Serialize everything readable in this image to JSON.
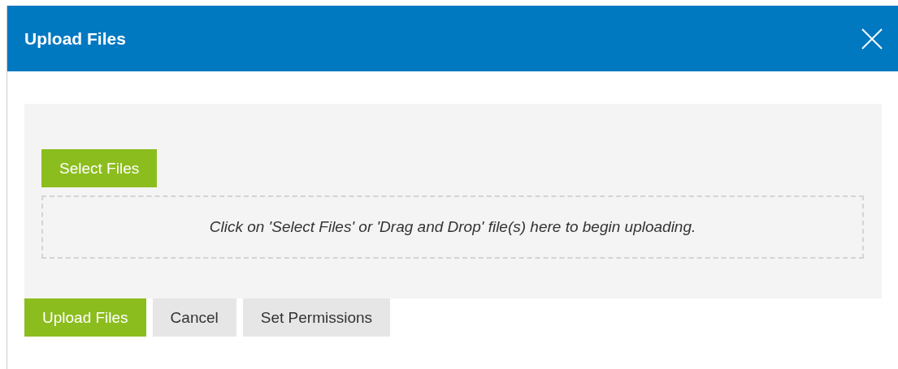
{
  "dialog": {
    "title": "Upload Files"
  },
  "select_button": "Select Files",
  "drop_zone": {
    "message": "Click on 'Select Files' or 'Drag and Drop' file(s) here to begin uploading."
  },
  "buttons": [
    {
      "label": "Upload Files",
      "kind": "primary"
    },
    {
      "label": "Cancel",
      "kind": "secondary"
    },
    {
      "label": "Set Permissions",
      "kind": "secondary"
    }
  ]
}
